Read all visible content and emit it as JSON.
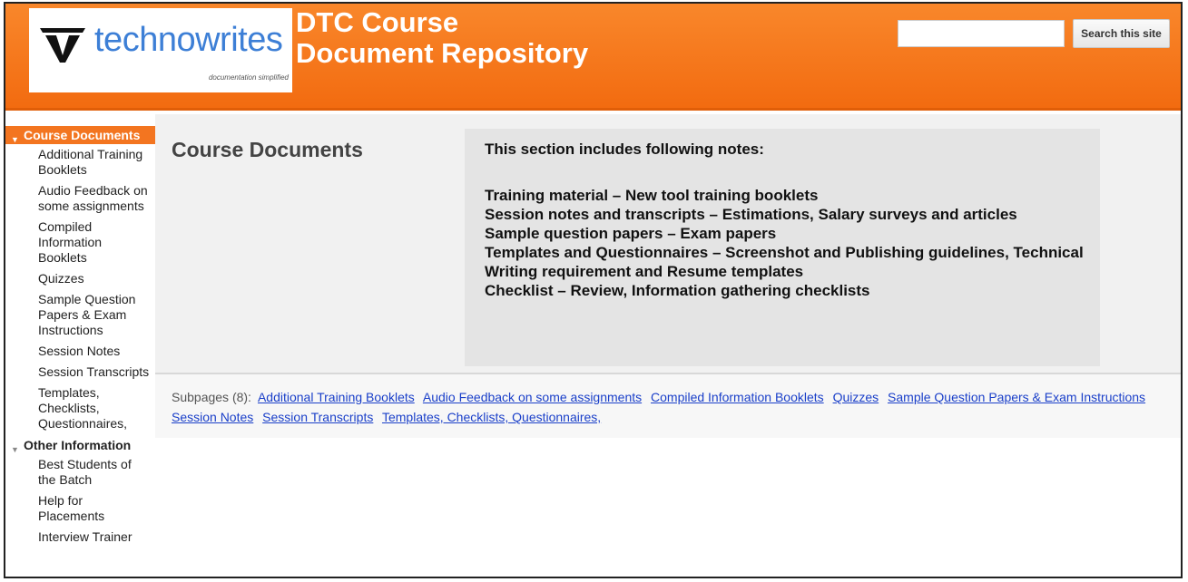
{
  "header": {
    "logo_text": "technowrites",
    "logo_tagline": "documentation simplified",
    "title_line1": "DTC Course",
    "title_line2": "Document Repository",
    "search_placeholder": "",
    "search_button": "Search this site"
  },
  "colors": {
    "header": "#f37520",
    "link": "#1a3fc9",
    "logo_blue": "#3d7fd6"
  },
  "sidebar": {
    "category1": "Course Documents",
    "items1": [
      "Additional Training Booklets",
      "Audio Feedback on some assignments",
      "Compiled Information Booklets",
      "Quizzes",
      "Sample Question Papers & Exam Instructions",
      "Session Notes",
      "Session Transcripts",
      "Templates, Checklists, Questionnaires,"
    ],
    "category2": "Other Information",
    "items2": [
      "Best Students of the Batch",
      "Help for Placements",
      "Interview Trainer"
    ]
  },
  "main": {
    "page_title": "Course Documents",
    "intro": "This section includes following notes:",
    "notes": [
      "Training material – New tool training booklets",
      "Session notes and transcripts – Estimations, Salary surveys and articles",
      "Sample question papers – Exam papers",
      "Templates and Questionnaires – Screenshot and Publishing guidelines, Technical Writing requirement and Resume templates",
      "Checklist – Review, Information gathering checklists"
    ],
    "subpages_label": "Subpages (8):",
    "subpages": [
      "Additional Training Booklets",
      "Audio Feedback on some assignments",
      "Compiled Information Booklets",
      "Quizzes",
      "Sample Question Papers & Exam Instructions",
      "Session Notes",
      "Session Transcripts",
      "Templates, Checklists, Questionnaires,"
    ]
  }
}
